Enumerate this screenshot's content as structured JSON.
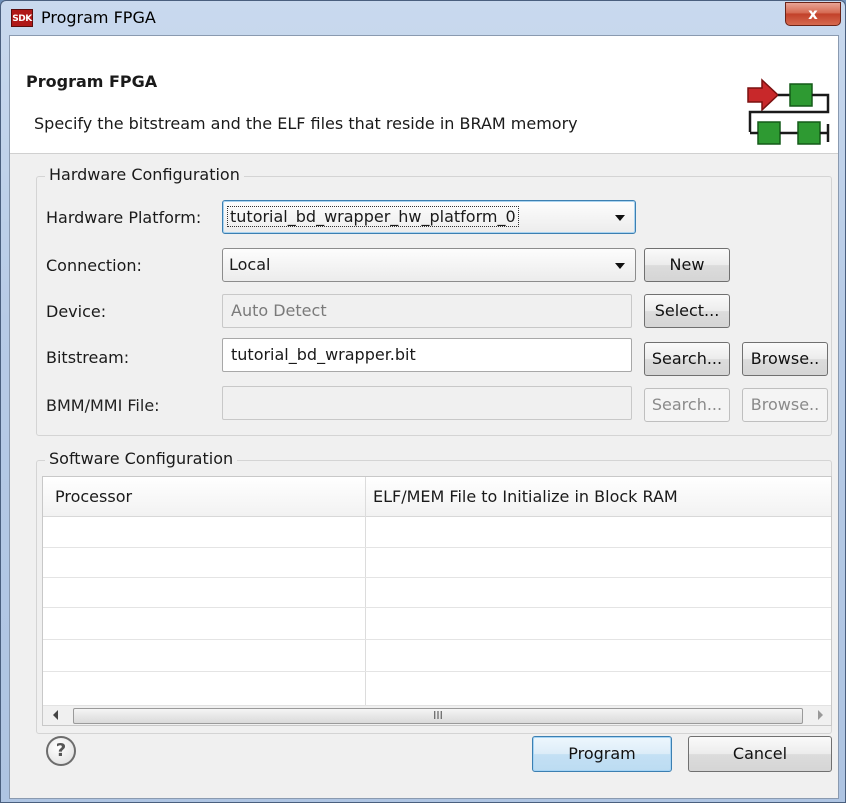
{
  "window": {
    "title": "Program FPGA",
    "app_icon_text": "SDK",
    "close_glyph": "x"
  },
  "header": {
    "title": "Program FPGA",
    "description": "Specify the bitstream and the ELF files that reside in BRAM memory",
    "banner_icon": "program-fpga-banner-icon"
  },
  "hardware": {
    "group_label": "Hardware Configuration",
    "platform_label": "Hardware Platform:",
    "platform_value": "tutorial_bd_wrapper_hw_platform_0",
    "connection_label": "Connection:",
    "connection_value": "Local",
    "new_button": "New",
    "device_label": "Device:",
    "device_value": "Auto Detect",
    "select_button": "Select...",
    "bitstream_label": "Bitstream:",
    "bitstream_value": "tutorial_bd_wrapper.bit",
    "bitstream_search": "Search...",
    "bitstream_browse": "Browse..",
    "bmm_label": "BMM/MMI File:",
    "bmm_value": "",
    "bmm_search": "Search...",
    "bmm_browse": "Browse.."
  },
  "software": {
    "group_label": "Software Configuration",
    "columns": [
      "Processor",
      "ELF/MEM File to Initialize in Block RAM"
    ],
    "scroll_thumb_glyph": "III"
  },
  "footer": {
    "help_glyph": "?",
    "program_button": "Program",
    "cancel_button": "Cancel"
  },
  "colors": {
    "accent": "#3c7fb1",
    "banner_red": "#c8282a",
    "banner_green": "#2e9a32"
  }
}
